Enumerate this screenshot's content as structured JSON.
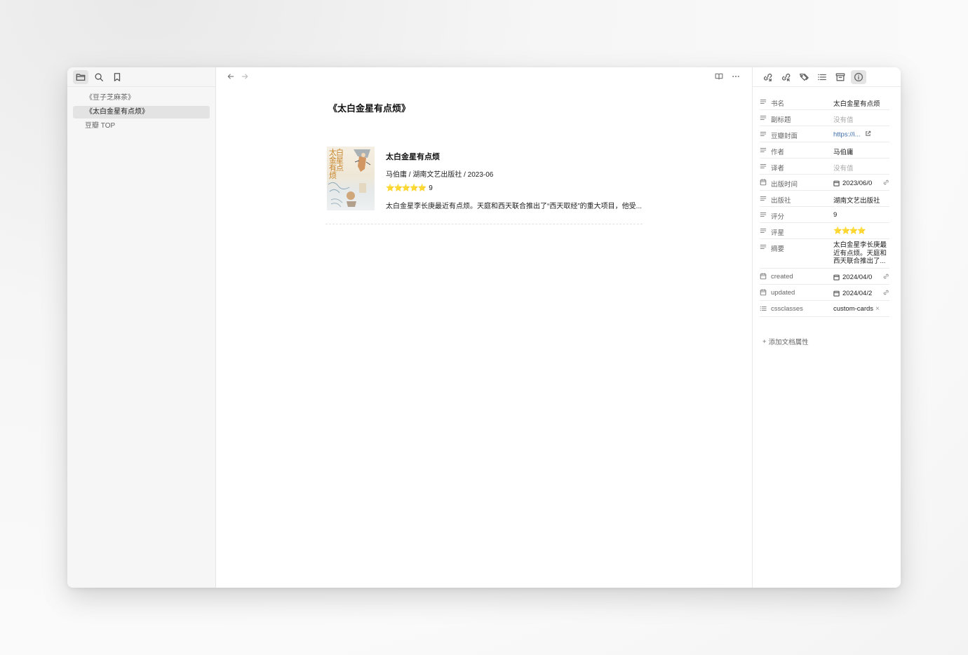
{
  "sidebar": {
    "files": [
      {
        "name": "《豆子芝麻茶》",
        "selected": false
      },
      {
        "name": "《太白金星有点烦》",
        "selected": true
      },
      {
        "name": "豆瓣 TOP",
        "selected": false
      }
    ]
  },
  "note": {
    "title": "《太白金星有点烦》"
  },
  "card": {
    "cover_text": "太白金星有点烦",
    "title": "太白金星有点烦",
    "meta": "马伯庸 / 湖南文艺出版社 / 2023-06",
    "stars": "⭐⭐⭐⭐⭐",
    "rating": "9",
    "summary": "太白金星李长庚最近有点烦。天庭和西天联合推出了“西天取经”的重大项目，他受..."
  },
  "properties": [
    {
      "icon": "text-icon",
      "key": "书名",
      "value": "太白金星有点烦",
      "kind": "text"
    },
    {
      "icon": "text-icon",
      "key": "副标题",
      "value": "没有值",
      "kind": "empty"
    },
    {
      "icon": "text-icon",
      "key": "豆瓣封面",
      "value": "https://i...",
      "kind": "link"
    },
    {
      "icon": "text-icon",
      "key": "作者",
      "value": "马伯庸",
      "kind": "text"
    },
    {
      "icon": "text-icon",
      "key": "译者",
      "value": "没有值",
      "kind": "empty"
    },
    {
      "icon": "calendar-icon",
      "key": "出版时间",
      "value": "2023/06/0",
      "kind": "date"
    },
    {
      "icon": "text-icon",
      "key": "出版社",
      "value": "湖南文艺出版社",
      "kind": "text"
    },
    {
      "icon": "text-icon",
      "key": "评分",
      "value": "9",
      "kind": "text"
    },
    {
      "icon": "text-icon",
      "key": "评星",
      "value": "⭐⭐⭐⭐",
      "kind": "stars"
    },
    {
      "icon": "text-icon",
      "key": "摘要",
      "value": "太白金星李长庚最近有点烦。天庭和西天联合推出了...",
      "kind": "multi"
    },
    {
      "icon": "calendar-icon",
      "key": "created",
      "value": "2024/04/0",
      "kind": "date"
    },
    {
      "icon": "calendar-icon",
      "key": "updated",
      "value": "2024/04/2",
      "kind": "date"
    },
    {
      "icon": "list-icon",
      "key": "cssclasses",
      "value": "custom-cards",
      "kind": "tag"
    }
  ],
  "add_property_label": "添加文档属性"
}
